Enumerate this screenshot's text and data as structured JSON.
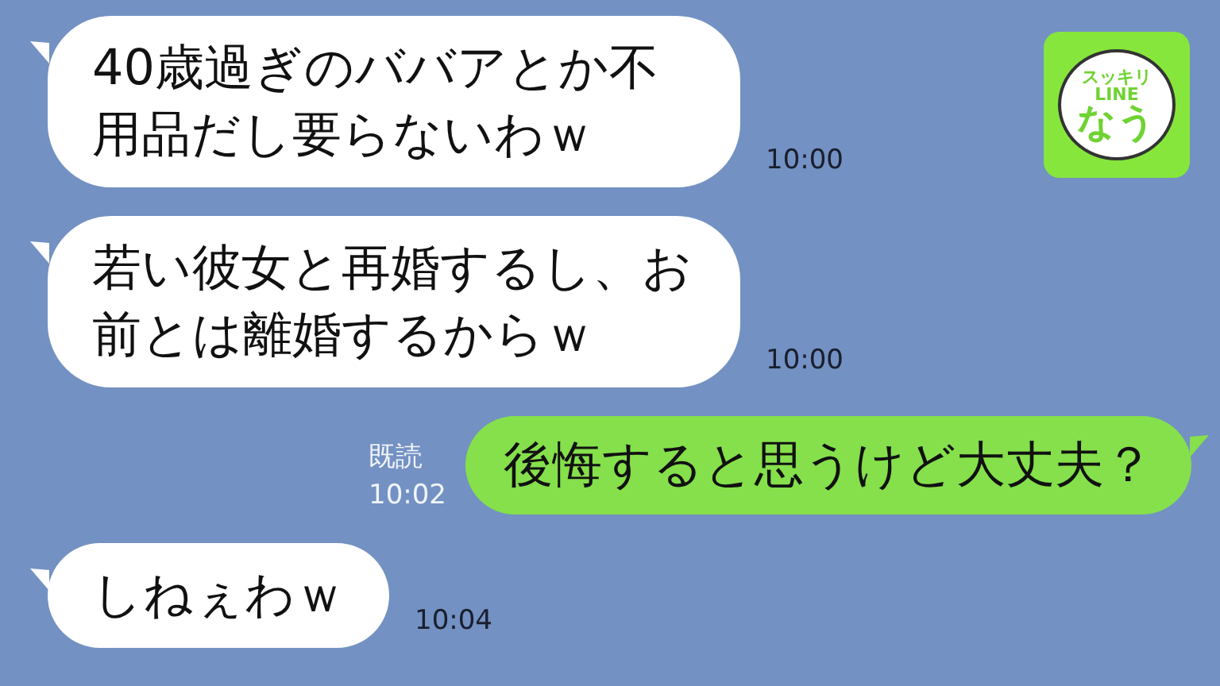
{
  "messages": [
    {
      "kind": "received",
      "text": "40歳過ぎのババアとか不用品だし要らないわｗ",
      "time": "10:00"
    },
    {
      "kind": "received",
      "text": "若い彼女と再婚するし、お前とは離婚するからｗ",
      "time": "10:00"
    },
    {
      "kind": "sent",
      "text": "後悔すると思うけど大丈夫？",
      "read": "既読",
      "time": "10:02"
    },
    {
      "kind": "received",
      "text": "しねぇわｗ",
      "time": "10:04"
    }
  ],
  "logo": {
    "top": "スッキリ",
    "middle": "LINE",
    "bottom": "なう"
  }
}
